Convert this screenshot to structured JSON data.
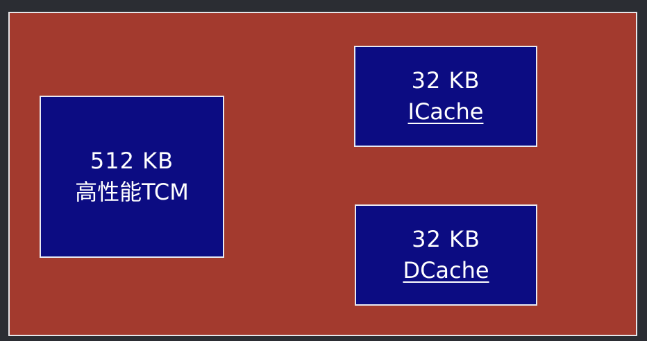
{
  "blocks": {
    "tcm": {
      "size": "512 KB",
      "name": "高性能TCM"
    },
    "icache": {
      "size": "32 KB",
      "name": "ICache"
    },
    "dcache": {
      "size": "32 KB",
      "name": "DCache"
    }
  },
  "colors": {
    "frame_background": "#a33a2e",
    "block_background": "#0c0c82",
    "border": "#e9e9f2",
    "text": "#ffffff"
  }
}
